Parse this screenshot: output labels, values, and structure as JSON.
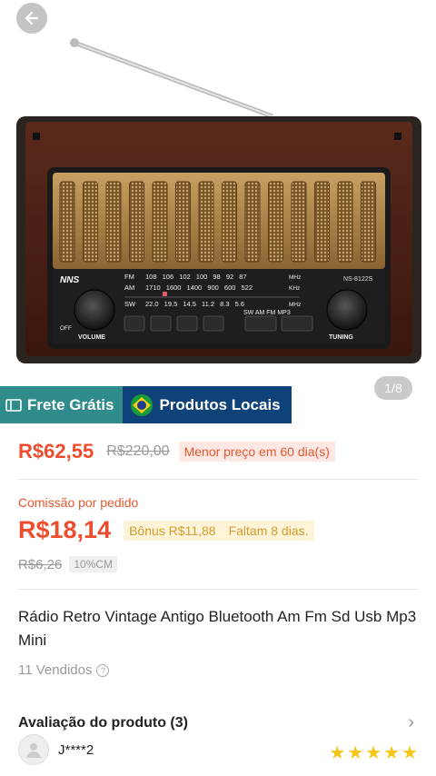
{
  "gallery": {
    "counter": "1/8"
  },
  "radio_graphic": {
    "brand": "NNS",
    "model": "NS-8122S",
    "fm_label": "FM",
    "fm_scale": "108 106 102 100 98 92 87",
    "mhz1": "MHz",
    "am_label": "AM",
    "am_scale": "1710 1600 1400 900 600 522",
    "khz": "KHz",
    "sw_label": "SW",
    "sw_scale": "22.0 19.5 14.5 11.2 8.3 5.6",
    "mhz2": "MHz",
    "mode_labels": "SW AM FM MP3",
    "volume_label": "VOLUME",
    "off_label": "OFF",
    "tuning_label": "TUNING"
  },
  "badges": {
    "frete": "Frete Grátis",
    "local": "Produtos Locais"
  },
  "price": {
    "current": "R$62,55",
    "old": "R$220,00",
    "lowest": "Menor preço em 60 dia(s)"
  },
  "commission": {
    "label": "Comissão por pedido",
    "value": "R$18,14",
    "bonus": "Bônus R$11,88",
    "remaining": "Faltam 8 dias.",
    "old": "R$6,26",
    "tag": "10%CM"
  },
  "product": {
    "title": "Rádio Retro Vintage Antigo Bluetooth Am Fm Sd Usb Mp3 Mini",
    "sold": "11 Vendidos"
  },
  "reviews": {
    "title": "Avaliação do produto (3)",
    "reviewer": "J****2",
    "rating": 5
  },
  "colors": {
    "accent": "#ee4d2d",
    "frete_bg": "#2f8c8a",
    "local_bg": "#10427a",
    "star": "#f5c518"
  }
}
